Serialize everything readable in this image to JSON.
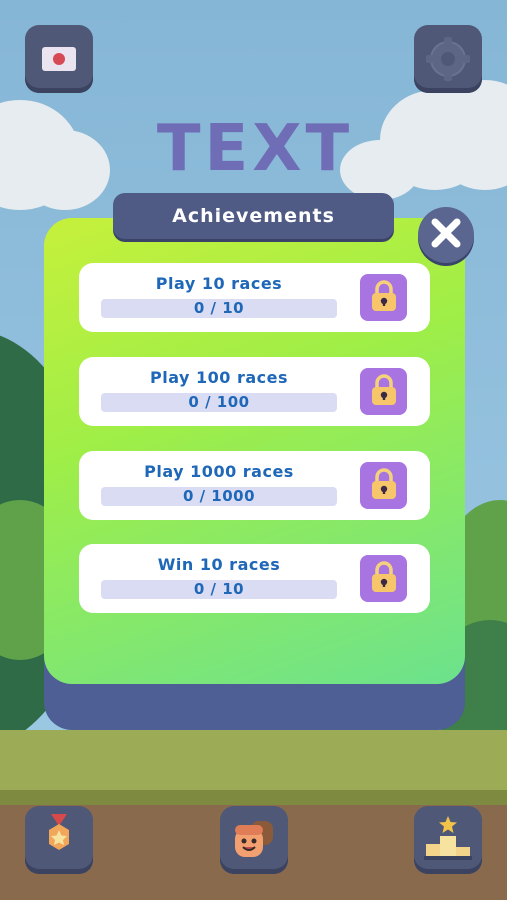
{
  "title_art": "TEXT",
  "popup": {
    "header": "Achievements",
    "close_icon": "close-icon"
  },
  "achievements": [
    {
      "title": "Play 10 races",
      "progress": "0 / 10",
      "current": 0,
      "target": 10,
      "icon": "lock-icon"
    },
    {
      "title": "Play 100 races",
      "progress": "0 / 100",
      "current": 0,
      "target": 100,
      "icon": "lock-icon"
    },
    {
      "title": "Play 1000 races",
      "progress": "0 / 1000",
      "current": 0,
      "target": 1000,
      "icon": "lock-icon"
    },
    {
      "title": "Win 10 races",
      "progress": "0 / 10",
      "current": 0,
      "target": 10,
      "icon": "lock-icon"
    }
  ],
  "top_buttons": {
    "left_icon": "screen-record-icon",
    "right_icon": "gear-icon"
  },
  "bottom_buttons": [
    {
      "icon": "medal-icon"
    },
    {
      "icon": "characters-icon"
    },
    {
      "icon": "podium-icon"
    }
  ],
  "colors": {
    "panel_gradient_start": "#c6f03b",
    "panel_gradient_end": "#6ce28d",
    "header_bg": "#4f5a85",
    "text_blue": "#1f67b8",
    "lock_bg": "#a874e2",
    "progress_track": "#d9dcf2"
  }
}
